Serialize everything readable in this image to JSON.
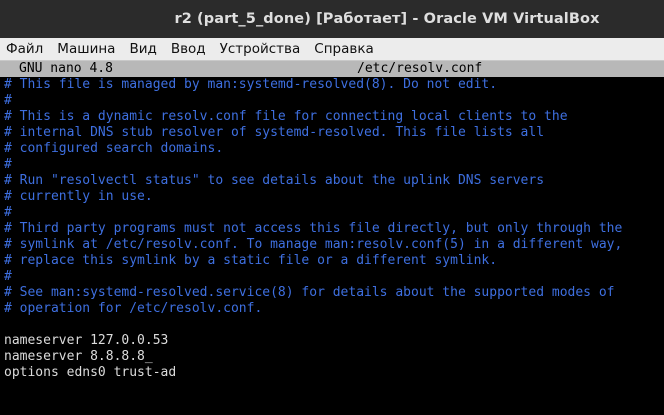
{
  "window": {
    "title": "r2 (part_5_done) [Работает] - Oracle VM VirtualBox"
  },
  "menu": {
    "items": [
      {
        "label": "Файл"
      },
      {
        "label": "Машина"
      },
      {
        "label": "Вид"
      },
      {
        "label": "Ввод"
      },
      {
        "label": "Устройства"
      },
      {
        "label": "Справка"
      }
    ]
  },
  "nano": {
    "version": "GNU nano 4.8",
    "filename": "/etc/resolv.conf"
  },
  "file": {
    "lines": [
      {
        "text": "# This file is managed by man:systemd-resolved(8). Do not edit.",
        "type": "comment"
      },
      {
        "text": "#",
        "type": "comment"
      },
      {
        "text": "# This is a dynamic resolv.conf file for connecting local clients to the",
        "type": "comment"
      },
      {
        "text": "# internal DNS stub resolver of systemd-resolved. This file lists all",
        "type": "comment"
      },
      {
        "text": "# configured search domains.",
        "type": "comment"
      },
      {
        "text": "#",
        "type": "comment"
      },
      {
        "text": "# Run \"resolvectl status\" to see details about the uplink DNS servers",
        "type": "comment"
      },
      {
        "text": "# currently in use.",
        "type": "comment"
      },
      {
        "text": "#",
        "type": "comment"
      },
      {
        "text": "# Third party programs must not access this file directly, but only through the",
        "type": "comment"
      },
      {
        "text": "# symlink at /etc/resolv.conf. To manage man:resolv.conf(5) in a different way,",
        "type": "comment"
      },
      {
        "text": "# replace this symlink by a static file or a different symlink.",
        "type": "comment"
      },
      {
        "text": "#",
        "type": "comment"
      },
      {
        "text": "# See man:systemd-resolved.service(8) for details about the supported modes of",
        "type": "comment"
      },
      {
        "text": "# operation for /etc/resolv.conf.",
        "type": "comment"
      },
      {
        "text": "",
        "type": "blank"
      },
      {
        "text": "nameserver 127.0.0.53",
        "type": "plain"
      },
      {
        "text": "nameserver 8.8.8.8",
        "type": "plain",
        "cursor": true
      },
      {
        "text": "options edns0 trust-ad",
        "type": "plain"
      }
    ]
  }
}
